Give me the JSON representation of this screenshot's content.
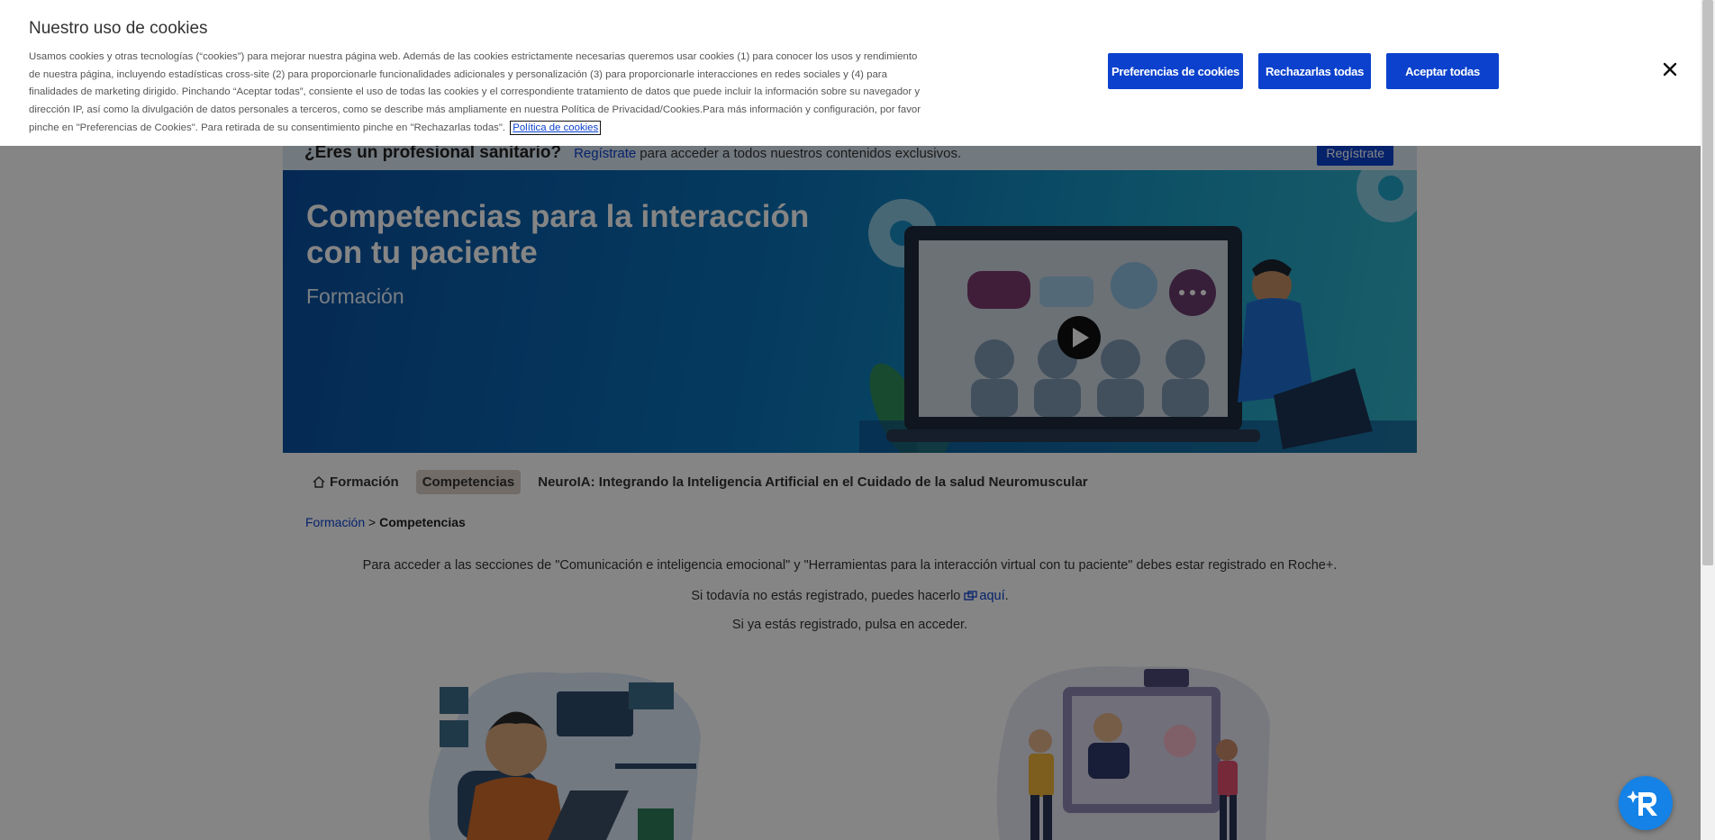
{
  "cookie_banner": {
    "title": "Nuestro uso de cookies",
    "body": "Usamos cookies y otras tecnologías (“cookies”) para mejorar nuestra página web. Además de las cookies estrictamente necesarias queremos usar cookies (1) para conocer los usos y rendimiento de nuestra página, incluyendo estadísticas cross-site (2) para proporcionarle funcionalidades adicionales y personalización (3) para proporcionarle interacciones en redes sociales y (4) para finalidades de marketing dirigido. Pinchando “Aceptar todas”, consiente el uso de todas las cookies y el correspondiente tratamiento de datos que puede incluir la información sobre su navegador y dirección IP, así como la divulgación de datos personales a terceros, como se describe más ampliamente en nuestra Política de Privacidad/Cookies.Para más información y configuración, por favor pinche en \"Preferencias de Cookies\". Para retirada de su consentimiento pinche en \"Rechazarlas todas\".",
    "policy_link": "Política de cookies",
    "buttons": {
      "preferences": "Preferencias de cookies",
      "reject": "Rechazarlas todas",
      "accept": "Aceptar todas"
    },
    "close_icon": "close-icon"
  },
  "register_strip": {
    "question": "¿Eres un profesional sanitario?",
    "link": "Regístrate",
    "rest": "para acceder a todos nuestros contenidos exclusivos.",
    "button": "Regístrate"
  },
  "hero": {
    "title": "Competencias para la interacción con tu paciente",
    "subtitle": "Formación"
  },
  "tabs": [
    {
      "label": "Formación",
      "icon": "home-icon",
      "active": false
    },
    {
      "label": "Competencias",
      "active": true
    },
    {
      "label": "NeuroIA: Integrando la Inteligencia Artificial en el Cuidado de la salud Neuromuscular",
      "active": false
    }
  ],
  "breadcrumb": {
    "parent": "Formación",
    "separator": ">",
    "current": "Competencias"
  },
  "info": {
    "line1": "Para acceder a las secciones de \"Comunicación e inteligencia emocional\" y \"Herramientas para la interacción virtual con tu paciente\" debes estar registrado en Roche+.",
    "line2_prefix": "Si todavía no estás registrado, puedes hacerlo",
    "line2_link": "aquí",
    "line2_suffix": ".",
    "line3": "Si ya estás registrado, pulsa en acceder."
  },
  "colors": {
    "brand_blue": "#0b41cd",
    "overlay": "rgba(0,0,0,0.48)",
    "fab_blue": "#1482e6",
    "active_tab": "#d8cfc8"
  },
  "icons": [
    "home-icon",
    "external-link-icon",
    "close-icon",
    "play-icon",
    "assistant-icon"
  ]
}
